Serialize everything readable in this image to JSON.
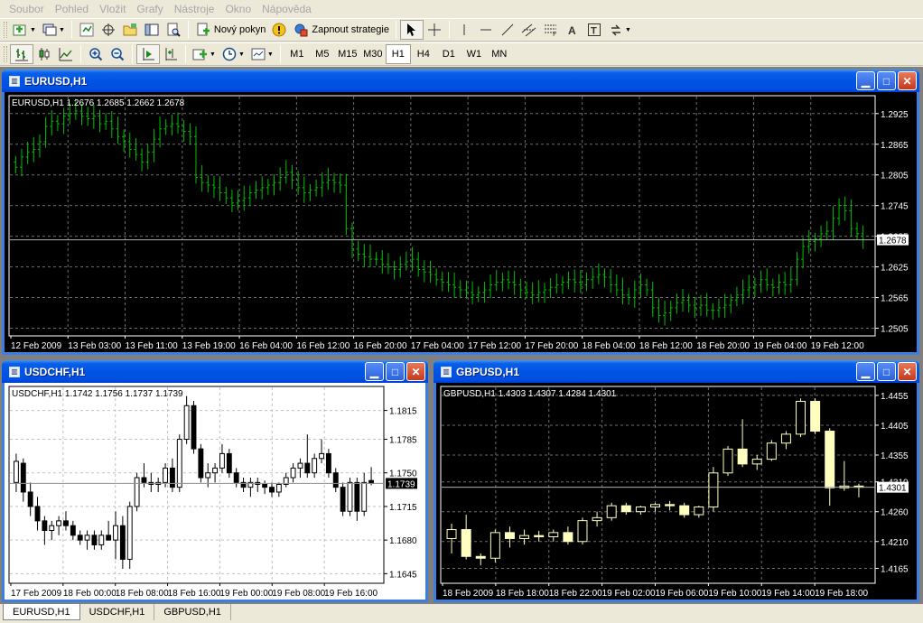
{
  "menu": [
    "Soubor",
    "Pohled",
    "Vložit",
    "Grafy",
    "Nástroje",
    "Okno",
    "Nápověda"
  ],
  "toolbar": {
    "new_order_label": "Nový pokyn",
    "strategy_label": "Zapnout strategie",
    "timeframes": [
      "M1",
      "M5",
      "M15",
      "M30",
      "H1",
      "H4",
      "D1",
      "W1",
      "MN"
    ],
    "active_timeframe": "H1"
  },
  "windows": {
    "eurusd": {
      "title": "EURUSD,H1",
      "info": "EURUSD,H1  1.2676 1.2685 1.2662 1.2678"
    },
    "usdchf": {
      "title": "USDCHF,H1",
      "info": "USDCHF,H1  1.1742 1.1756 1.1737 1.1739"
    },
    "gbpusd": {
      "title": "GBPUSD,H1",
      "info": "GBPUSD,H1  1.4303 1.4307 1.4284 1.4301"
    }
  },
  "tabs": [
    "EURUSD,H1",
    "USDCHF,H1",
    "GBPUSD,H1"
  ],
  "colors": {
    "title_blue": "#0054e3",
    "eur_bars": "#00c000",
    "gbp_candles": "#ffffc0",
    "dark_bg": "#000000",
    "light_bg": "#ffffff"
  },
  "chart_data": [
    {
      "type": "ohlc-bar",
      "symbol": "EURUSD",
      "timeframe": "H1",
      "theme": "dark",
      "bar_color": "#00c000",
      "ylim": [
        1.249,
        1.296
      ],
      "y_ticks": [
        "1.2925",
        "1.2865",
        "1.2805",
        "1.2745",
        "1.2685",
        "1.2625",
        "1.2565",
        "1.2505"
      ],
      "x_ticks": [
        "12 Feb 2009",
        "13 Feb 03:00",
        "13 Feb 11:00",
        "13 Feb 19:00",
        "16 Feb 04:00",
        "16 Feb 12:00",
        "16 Feb 20:00",
        "17 Feb 04:00",
        "17 Feb 12:00",
        "17 Feb 20:00",
        "18 Feb 04:00",
        "18 Feb 12:00",
        "18 Feb 20:00",
        "19 Feb 04:00",
        "19 Feb 12:00"
      ],
      "last_price": "1.2678",
      "last_value": 1.2678,
      "close": [
        1.282,
        1.284,
        1.285,
        1.2855,
        1.287,
        1.29,
        1.291,
        1.2905,
        1.292,
        1.2925,
        1.293,
        1.292,
        1.2915,
        1.292,
        1.2905,
        1.291,
        1.2895,
        1.288,
        1.287,
        1.2855,
        1.2845,
        1.283,
        1.285,
        1.2875,
        1.2895,
        1.29,
        1.2905,
        1.29,
        1.289,
        1.288,
        1.28,
        1.279,
        1.2785,
        1.278,
        1.277,
        1.276,
        1.275,
        1.2755,
        1.276,
        1.277,
        1.2775,
        1.278,
        1.2785,
        1.279,
        1.28,
        1.281,
        1.2795,
        1.278,
        1.277,
        1.2775,
        1.278,
        1.279,
        1.2795,
        1.279,
        1.2785,
        1.27,
        1.266,
        1.265,
        1.2645,
        1.264,
        1.264,
        1.263,
        1.2625,
        1.262,
        1.263,
        1.2635,
        1.264,
        1.262,
        1.2615,
        1.261,
        1.26,
        1.2595,
        1.259,
        1.2585,
        1.258,
        1.2575,
        1.257,
        1.2575,
        1.258,
        1.259,
        1.2595,
        1.26,
        1.2595,
        1.259,
        1.258,
        1.2575,
        1.257,
        1.2575,
        1.258,
        1.2585,
        1.259,
        1.2595,
        1.26,
        1.2595,
        1.259,
        1.26,
        1.2605,
        1.261,
        1.2605,
        1.259,
        1.258,
        1.257,
        1.2565,
        1.258,
        1.259,
        1.258,
        1.2545,
        1.253,
        1.2535,
        1.2545,
        1.2555,
        1.256,
        1.255,
        1.2545,
        1.255,
        1.254,
        1.254,
        1.2545,
        1.255,
        1.256,
        1.257,
        1.258,
        1.2585,
        1.259,
        1.26,
        1.259,
        1.2585,
        1.2595,
        1.259,
        1.26,
        1.264,
        1.2665,
        1.2675,
        1.268,
        1.269,
        1.2695,
        1.272,
        1.2745,
        1.2735,
        1.27,
        1.269,
        1.2678
      ]
    },
    {
      "type": "candlestick",
      "symbol": "USDCHF",
      "timeframe": "H1",
      "theme": "light",
      "ylim": [
        1.1635,
        1.184
      ],
      "y_ticks": [
        "1.1815",
        "1.1785",
        "1.1750",
        "1.1715",
        "1.1680",
        "1.1645"
      ],
      "x_ticks": [
        "17 Feb 2009",
        "18 Feb 00:00",
        "18 Feb 08:00",
        "18 Feb 16:00",
        "19 Feb 00:00",
        "19 Feb 08:00",
        "19 Feb 16:00"
      ],
      "last_price": "1.1739",
      "last_value": 1.1739,
      "ohlc": [
        [
          1.174,
          1.177,
          1.173,
          1.1762
        ],
        [
          1.176,
          1.1765,
          1.172,
          1.173
        ],
        [
          1.173,
          1.174,
          1.1705,
          1.1715
        ],
        [
          1.1715,
          1.1725,
          1.169,
          1.17
        ],
        [
          1.17,
          1.1705,
          1.1675,
          1.169
        ],
        [
          1.169,
          1.17,
          1.168,
          1.1695
        ],
        [
          1.1695,
          1.1705,
          1.1685,
          1.17
        ],
        [
          1.17,
          1.171,
          1.169,
          1.1695
        ],
        [
          1.1695,
          1.17,
          1.168,
          1.1685
        ],
        [
          1.1685,
          1.169,
          1.1675,
          1.168
        ],
        [
          1.168,
          1.169,
          1.167,
          1.1685
        ],
        [
          1.1685,
          1.169,
          1.167,
          1.1675
        ],
        [
          1.1675,
          1.169,
          1.167,
          1.1685
        ],
        [
          1.1685,
          1.17,
          1.168,
          1.168
        ],
        [
          1.168,
          1.171,
          1.166,
          1.1695
        ],
        [
          1.1695,
          1.1705,
          1.165,
          1.166
        ],
        [
          1.166,
          1.172,
          1.165,
          1.1715
        ],
        [
          1.1715,
          1.175,
          1.171,
          1.1745
        ],
        [
          1.1745,
          1.176,
          1.1735,
          1.174
        ],
        [
          1.174,
          1.175,
          1.173,
          1.1738
        ],
        [
          1.1738,
          1.1745,
          1.173,
          1.174
        ],
        [
          1.174,
          1.176,
          1.1735,
          1.1755
        ],
        [
          1.1755,
          1.1765,
          1.173,
          1.1735
        ],
        [
          1.1735,
          1.179,
          1.173,
          1.1785
        ],
        [
          1.1785,
          1.183,
          1.178,
          1.182
        ],
        [
          1.182,
          1.1825,
          1.177,
          1.1775
        ],
        [
          1.1775,
          1.178,
          1.174,
          1.1745
        ],
        [
          1.1745,
          1.176,
          1.1735,
          1.175
        ],
        [
          1.175,
          1.176,
          1.174,
          1.1755
        ],
        [
          1.1755,
          1.178,
          1.175,
          1.177
        ],
        [
          1.177,
          1.1775,
          1.1745,
          1.175
        ],
        [
          1.175,
          1.1755,
          1.1735,
          1.174
        ],
        [
          1.174,
          1.1745,
          1.173,
          1.1735
        ],
        [
          1.1735,
          1.1745,
          1.1725,
          1.174
        ],
        [
          1.174,
          1.1745,
          1.173,
          1.1738
        ],
        [
          1.1738,
          1.1742,
          1.1728,
          1.1735
        ],
        [
          1.1735,
          1.174,
          1.1725,
          1.173
        ],
        [
          1.173,
          1.174,
          1.1725,
          1.1738
        ],
        [
          1.1738,
          1.175,
          1.1735,
          1.1745
        ],
        [
          1.1745,
          1.176,
          1.174,
          1.1755
        ],
        [
          1.1755,
          1.1765,
          1.1745,
          1.176
        ],
        [
          1.176,
          1.179,
          1.1745,
          1.175
        ],
        [
          1.175,
          1.177,
          1.1745,
          1.1765
        ],
        [
          1.1765,
          1.1785,
          1.176,
          1.177
        ],
        [
          1.177,
          1.1775,
          1.1745,
          1.175
        ],
        [
          1.175,
          1.1755,
          1.173,
          1.1735
        ],
        [
          1.1735,
          1.174,
          1.1705,
          1.171
        ],
        [
          1.171,
          1.1745,
          1.1705,
          1.174
        ],
        [
          1.174,
          1.1745,
          1.17,
          1.171
        ],
        [
          1.171,
          1.175,
          1.1705,
          1.174
        ],
        [
          1.1742,
          1.1756,
          1.1737,
          1.1739
        ]
      ]
    },
    {
      "type": "candlestick",
      "symbol": "GBPUSD",
      "timeframe": "H1",
      "theme": "dark",
      "candle_color": "#ffffc0",
      "ylim": [
        1.414,
        1.447
      ],
      "y_ticks": [
        "1.4455",
        "1.4405",
        "1.4355",
        "1.4310",
        "1.4260",
        "1.4210",
        "1.4165"
      ],
      "x_ticks": [
        "18 Feb 2009",
        "18 Feb 18:00",
        "18 Feb 22:00",
        "19 Feb 02:00",
        "19 Feb 06:00",
        "19 Feb 10:00",
        "19 Feb 14:00",
        "19 Feb 18:00"
      ],
      "last_price": "1.4301",
      "last_value": 1.4301,
      "ohlc": [
        [
          1.4215,
          1.424,
          1.419,
          1.423
        ],
        [
          1.423,
          1.4255,
          1.418,
          1.4185
        ],
        [
          1.4185,
          1.419,
          1.417,
          1.4182
        ],
        [
          1.4182,
          1.423,
          1.4175,
          1.4225
        ],
        [
          1.4225,
          1.4235,
          1.42,
          1.4215
        ],
        [
          1.4215,
          1.423,
          1.4205,
          1.422
        ],
        [
          1.422,
          1.4228,
          1.421,
          1.4218
        ],
        [
          1.4218,
          1.423,
          1.421,
          1.4225
        ],
        [
          1.4225,
          1.4235,
          1.4205,
          1.421
        ],
        [
          1.421,
          1.425,
          1.4205,
          1.4245
        ],
        [
          1.4245,
          1.426,
          1.4235,
          1.425
        ],
        [
          1.425,
          1.4275,
          1.4245,
          1.427
        ],
        [
          1.427,
          1.4275,
          1.4255,
          1.426
        ],
        [
          1.426,
          1.427,
          1.4255,
          1.4268
        ],
        [
          1.4268,
          1.4275,
          1.426,
          1.4272
        ],
        [
          1.4272,
          1.4278,
          1.4262,
          1.427
        ],
        [
          1.427,
          1.4275,
          1.425,
          1.4255
        ],
        [
          1.4255,
          1.427,
          1.425,
          1.4268
        ],
        [
          1.4268,
          1.4335,
          1.426,
          1.4325
        ],
        [
          1.4325,
          1.437,
          1.432,
          1.4365
        ],
        [
          1.4365,
          1.4415,
          1.4335,
          1.434
        ],
        [
          1.434,
          1.4355,
          1.433,
          1.4348
        ],
        [
          1.4348,
          1.438,
          1.4345,
          1.4375
        ],
        [
          1.4375,
          1.4395,
          1.4365,
          1.439
        ],
        [
          1.439,
          1.445,
          1.4385,
          1.4445
        ],
        [
          1.4445,
          1.445,
          1.439,
          1.4395
        ],
        [
          1.4395,
          1.44,
          1.427,
          1.43
        ],
        [
          1.43,
          1.4345,
          1.4295,
          1.4303
        ],
        [
          1.4303,
          1.4307,
          1.4284,
          1.4301
        ]
      ]
    }
  ]
}
